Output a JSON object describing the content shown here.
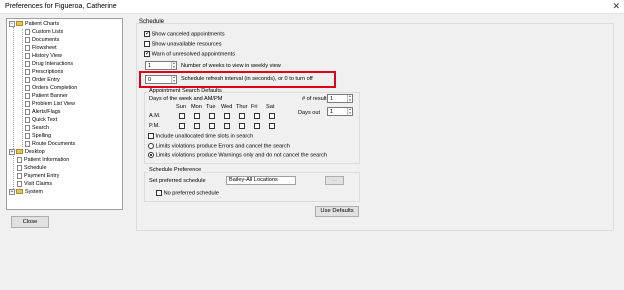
{
  "window": {
    "title": "Preferences for Figueroa, Catherine",
    "close_glyph": "✕"
  },
  "tree": {
    "items": [
      {
        "label": "Patient Charts",
        "level": 0,
        "kind": "folder",
        "expander": "−"
      },
      {
        "label": "Custom Lists",
        "level": 1,
        "kind": "doc"
      },
      {
        "label": "Documents",
        "level": 1,
        "kind": "doc"
      },
      {
        "label": "Flowsheet",
        "level": 1,
        "kind": "doc"
      },
      {
        "label": "History View",
        "level": 1,
        "kind": "doc"
      },
      {
        "label": "Drug Interactions",
        "level": 1,
        "kind": "doc"
      },
      {
        "label": "Prescriptions",
        "level": 1,
        "kind": "doc"
      },
      {
        "label": "Order Entry",
        "level": 1,
        "kind": "doc"
      },
      {
        "label": "Orders Completion",
        "level": 1,
        "kind": "doc"
      },
      {
        "label": "Patient Banner",
        "level": 1,
        "kind": "doc"
      },
      {
        "label": "Problem List View",
        "level": 1,
        "kind": "doc"
      },
      {
        "label": "Alerts/Flags",
        "level": 1,
        "kind": "doc"
      },
      {
        "label": "Quick Text",
        "level": 1,
        "kind": "doc"
      },
      {
        "label": "Search",
        "level": 1,
        "kind": "doc"
      },
      {
        "label": "Spelling",
        "level": 1,
        "kind": "doc"
      },
      {
        "label": "Route Documents",
        "level": 1,
        "kind": "doc"
      },
      {
        "label": "Desktop",
        "level": 0,
        "kind": "folder",
        "expander": "+"
      },
      {
        "label": "Patient Information",
        "level": 0,
        "kind": "doc"
      },
      {
        "label": "Schedule",
        "level": 0,
        "kind": "doc"
      },
      {
        "label": "Payment Entry",
        "level": 0,
        "kind": "doc"
      },
      {
        "label": "Visit Claims",
        "level": 0,
        "kind": "doc"
      },
      {
        "label": "System",
        "level": 0,
        "kind": "folder",
        "expander": "+"
      }
    ]
  },
  "close_button": "Close",
  "schedule": {
    "group_label": "Schedule",
    "show_canceled": "Show canceled appointments",
    "show_unavailable": "Show unavailable resources",
    "warn_unresolved": "Warn of unresolved appointments",
    "weeks_value": "1",
    "weeks_label": "Number of weeks to view in weekly view",
    "refresh_value": "0",
    "refresh_label": "Schedule refresh interval (in seconds), or 0 to turn off",
    "search_defaults": {
      "label": "Appointment Search Defaults",
      "days_label": "Days of the week and AM/PM",
      "days": [
        "Sun",
        "Mon",
        "Tue",
        "Wed",
        "Thur",
        "Fri",
        "Sat"
      ],
      "am": "A.M.",
      "pm": "P.M.",
      "results_label": "# of results",
      "results_value": "1",
      "days_out_label": "Days out",
      "days_out_value": "1",
      "include_unallocated": "Include unallocated time slots in search",
      "radio_errors": "Limits violations produce Errors and cancel the search",
      "radio_warnings": "Limits violations produce Warnings only and do not cancel the search"
    },
    "preference": {
      "label": "Schedule Preference",
      "set_label": "Set preferred schedule",
      "value": "Bailey-All Locations",
      "browse": "...",
      "no_preferred": "No preferred schedule"
    },
    "use_defaults": "Use Defaults",
    "check_glyph": "✓"
  }
}
